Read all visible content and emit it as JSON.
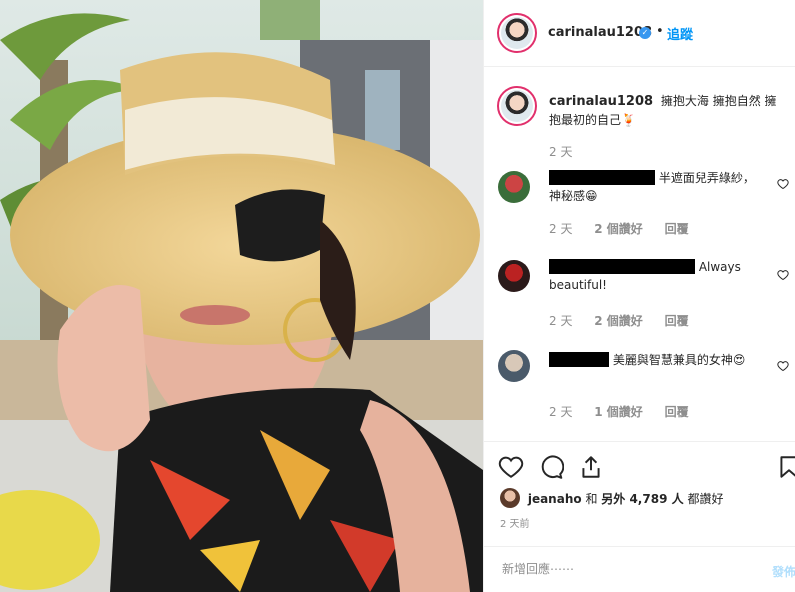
{
  "post": {
    "author": "carinalau1208",
    "follow_label": "追蹤",
    "dot": "•",
    "caption": "擁抱大海 擁抱自然 擁抱最初的自己🍹",
    "caption_time": "2 天"
  },
  "comments": [
    {
      "text": "半遮面兒弄綠紗，神秘感😁",
      "time": "2 天",
      "likes": "2 個讚好",
      "reply": "回覆"
    },
    {
      "text": "Always beautiful!",
      "time": "2 天",
      "likes": "2 個讚好",
      "reply": "回覆"
    },
    {
      "text": "美麗與智慧兼具的女神😍",
      "time": "2 天",
      "likes": "1 個讚好",
      "reply": "回覆"
    }
  ],
  "likes": {
    "user": "jeanaho",
    "and": "和",
    "others": "另外 4,789 人",
    "suffix": "都讚好"
  },
  "time_ago": "2 天前",
  "add_comment": {
    "placeholder": "新增回應⋯⋯",
    "post_label": "發佈"
  },
  "colors": {
    "accent": "#0095f6",
    "story_ring": "#e1306c",
    "muted": "#8e8e8e"
  },
  "icons": [
    "heart-icon",
    "comment-icon",
    "share-icon",
    "bookmark-icon",
    "verified-badge-icon"
  ]
}
